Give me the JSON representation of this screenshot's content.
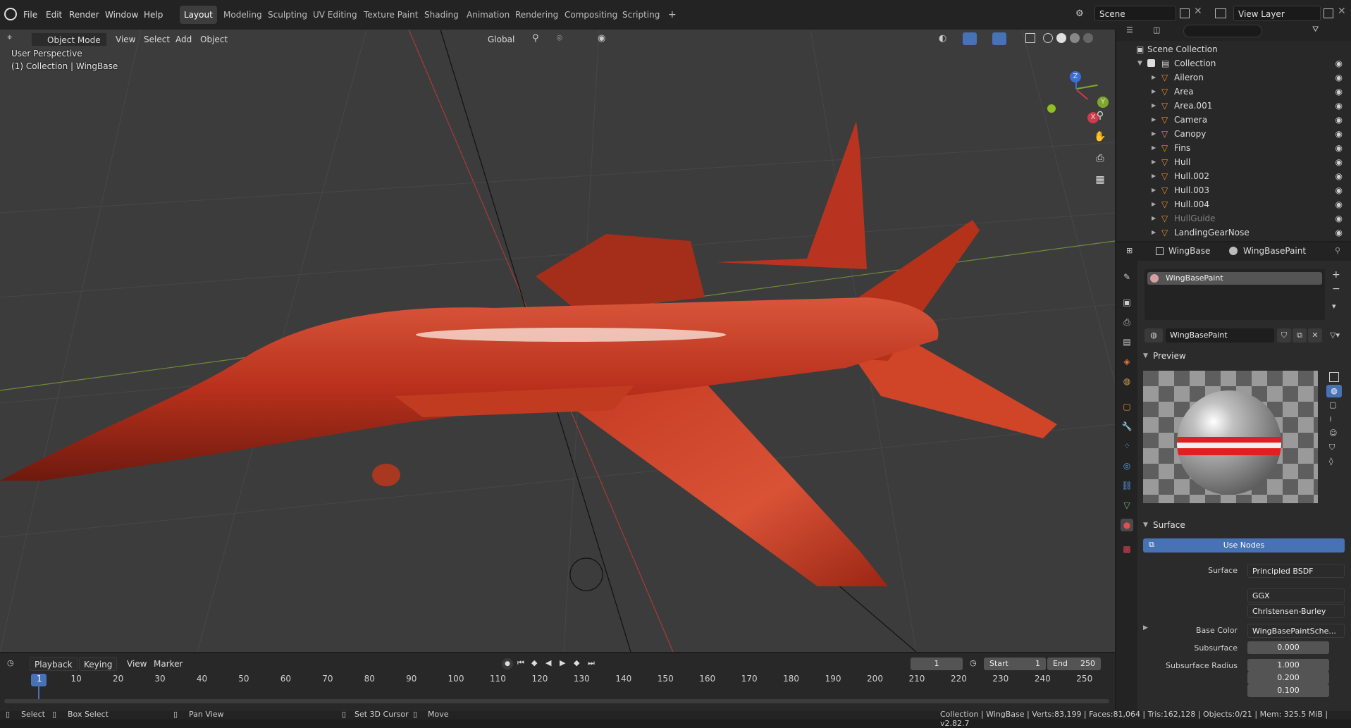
{
  "topbar": {
    "menus": [
      "File",
      "Edit",
      "Render",
      "Window",
      "Help"
    ],
    "workspaces": [
      "Layout",
      "Modeling",
      "Sculpting",
      "UV Editing",
      "Texture Paint",
      "Shading",
      "Animation",
      "Rendering",
      "Compositing",
      "Scripting"
    ],
    "add_tab": "+",
    "scene": "Scene",
    "view_layer": "View Layer"
  },
  "viewport_header": {
    "mode": "Object Mode",
    "menus": [
      "View",
      "Select",
      "Add",
      "Object"
    ],
    "transform_orientation": "Global"
  },
  "viewport": {
    "perspective": "User Perspective",
    "collection_info": "(1) Collection | WingBase",
    "gizmo": {
      "z": "Z",
      "y": "Y",
      "x": "X"
    },
    "model_color": "#c8391f"
  },
  "outliner": {
    "search_placeholder": "",
    "scene_collection": "Scene Collection",
    "collection": "Collection",
    "items": [
      "Aileron",
      "Area",
      "Area.001",
      "Camera",
      "Canopy",
      "Fins",
      "Hull",
      "Hull.002",
      "Hull.003",
      "Hull.004",
      "HullGuide",
      "LandingGearNose"
    ]
  },
  "properties": {
    "object": "WingBase",
    "material": "WingBasePaint",
    "slot": "WingBasePaint",
    "datablock": "WingBasePaint",
    "preview_title": "Preview",
    "surface_title": "Surface",
    "use_nodes": "Use Nodes",
    "surface_label": "Surface",
    "surface_value": "Principled BSDF",
    "distribution": "GGX",
    "subsurface_method": "Christensen-Burley",
    "base_color_label": "Base Color",
    "base_color_value": "WingBasePaintSche...",
    "subsurface_label": "Subsurface",
    "subsurface_value": "0.000",
    "subsurface_radius_label": "Subsurface Radius",
    "subsurface_radius": [
      "1.000",
      "0.200",
      "0.100"
    ]
  },
  "timeline": {
    "menus": [
      "Playback",
      "Keying",
      "View",
      "Marker"
    ],
    "current_frame": "1",
    "start_label": "Start",
    "start": "1",
    "end_label": "End",
    "end": "250",
    "ticks": [
      "1",
      "10",
      "20",
      "30",
      "40",
      "50",
      "60",
      "70",
      "80",
      "90",
      "100",
      "110",
      "120",
      "130",
      "140",
      "150",
      "160",
      "170",
      "180",
      "190",
      "200",
      "210",
      "220",
      "230",
      "240",
      "250"
    ]
  },
  "statusbar": {
    "select": "Select",
    "box_select": "Box Select",
    "pan_view": "Pan View",
    "set_cursor": "Set 3D Cursor",
    "move": "Move",
    "stats": "Collection | WingBase | Verts:83,199 | Faces:81,064 | Tris:162,128 | Objects:0/21 | Mem: 325.5 MiB | v2.82.7"
  }
}
